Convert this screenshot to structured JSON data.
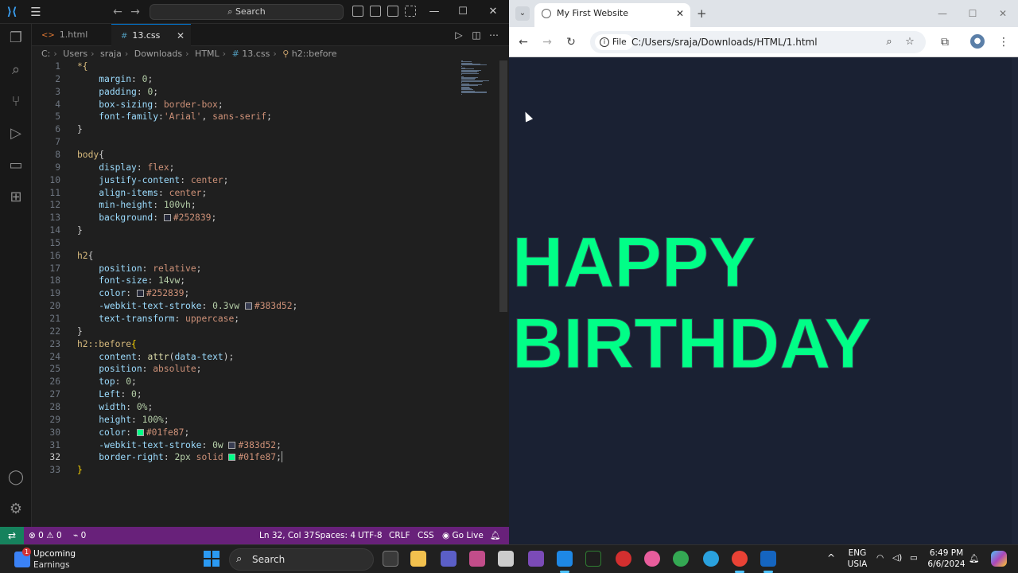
{
  "vscode": {
    "search_label": "Search",
    "tabs": [
      {
        "label": "1.html",
        "icon": "html-file-icon",
        "active": false
      },
      {
        "label": "13.css",
        "icon": "css-file-icon",
        "active": true
      }
    ],
    "breadcrumb": [
      "C:",
      "Users",
      "sraja",
      "Downloads",
      "HTML",
      "13.css",
      "h2::before"
    ],
    "code_lines": [
      [
        [
          "*{",
          "sel"
        ]
      ],
      [
        [
          "    ",
          ""
        ],
        [
          "margin",
          "prop"
        ],
        [
          ": ",
          "punc"
        ],
        [
          "0",
          "num"
        ],
        [
          ";",
          "punc"
        ]
      ],
      [
        [
          "    ",
          ""
        ],
        [
          "padding",
          "prop"
        ],
        [
          ": ",
          "punc"
        ],
        [
          "0",
          "num"
        ],
        [
          ";",
          "punc"
        ]
      ],
      [
        [
          "    ",
          ""
        ],
        [
          "box-sizing",
          "prop"
        ],
        [
          ": ",
          "punc"
        ],
        [
          "border-box",
          "val"
        ],
        [
          ";",
          "punc"
        ]
      ],
      [
        [
          "    ",
          ""
        ],
        [
          "font-family",
          "prop"
        ],
        [
          ":",
          "punc"
        ],
        [
          "'Arial'",
          "val"
        ],
        [
          ", ",
          "punc"
        ],
        [
          "sans-serif",
          "val"
        ],
        [
          ";",
          "punc"
        ]
      ],
      [
        [
          "}",
          "punc"
        ]
      ],
      [],
      [
        [
          "body",
          "sel"
        ],
        [
          "{",
          "punc"
        ]
      ],
      [
        [
          "    ",
          ""
        ],
        [
          "display",
          "prop"
        ],
        [
          ": ",
          "punc"
        ],
        [
          "flex",
          "val"
        ],
        [
          ";",
          "punc"
        ]
      ],
      [
        [
          "    ",
          ""
        ],
        [
          "justify-content",
          "prop"
        ],
        [
          ": ",
          "punc"
        ],
        [
          "center",
          "val"
        ],
        [
          ";",
          "punc"
        ]
      ],
      [
        [
          "    ",
          ""
        ],
        [
          "align-items",
          "prop"
        ],
        [
          ": ",
          "punc"
        ],
        [
          "center",
          "val"
        ],
        [
          ";",
          "punc"
        ]
      ],
      [
        [
          "    ",
          ""
        ],
        [
          "min-height",
          "prop"
        ],
        [
          ": ",
          "punc"
        ],
        [
          "100vh",
          "num"
        ],
        [
          ";",
          "punc"
        ]
      ],
      [
        [
          "    ",
          ""
        ],
        [
          "background",
          "prop"
        ],
        [
          ": ",
          "punc"
        ],
        [
          "#252839",
          "swatch:#252839"
        ],
        [
          "#252839",
          "val"
        ],
        [
          ";",
          "punc"
        ]
      ],
      [
        [
          "}",
          "punc"
        ]
      ],
      [],
      [
        [
          "h2",
          "sel"
        ],
        [
          "{",
          "punc"
        ]
      ],
      [
        [
          "    ",
          ""
        ],
        [
          "position",
          "prop"
        ],
        [
          ": ",
          "punc"
        ],
        [
          "relative",
          "val"
        ],
        [
          ";",
          "punc"
        ]
      ],
      [
        [
          "    ",
          ""
        ],
        [
          "font-size",
          "prop"
        ],
        [
          ": ",
          "punc"
        ],
        [
          "14vw",
          "num"
        ],
        [
          ";",
          "punc"
        ]
      ],
      [
        [
          "    ",
          ""
        ],
        [
          "color",
          "prop"
        ],
        [
          ": ",
          "punc"
        ],
        [
          "#252839",
          "swatch:#252839"
        ],
        [
          "#252839",
          "val"
        ],
        [
          ";",
          "punc"
        ]
      ],
      [
        [
          "    ",
          ""
        ],
        [
          "-webkit-text-stroke",
          "prop"
        ],
        [
          ": ",
          "punc"
        ],
        [
          "0.3vw",
          "num"
        ],
        [
          " ",
          "punc"
        ],
        [
          "#383d52",
          "swatch:#383d52"
        ],
        [
          "#383d52",
          "val"
        ],
        [
          ";",
          "punc"
        ]
      ],
      [
        [
          "    ",
          ""
        ],
        [
          "text-transform",
          "prop"
        ],
        [
          ": ",
          "punc"
        ],
        [
          "uppercase",
          "val"
        ],
        [
          ";",
          "punc"
        ]
      ],
      [
        [
          "}",
          "punc"
        ]
      ],
      [
        [
          "h2::before",
          "sel"
        ],
        [
          "{",
          "brace"
        ]
      ],
      [
        [
          "    ",
          ""
        ],
        [
          "content",
          "prop"
        ],
        [
          ": ",
          "punc"
        ],
        [
          "attr",
          "fn"
        ],
        [
          "(",
          "punc"
        ],
        [
          "data-text",
          "prop"
        ],
        [
          ");",
          "punc"
        ]
      ],
      [
        [
          "    ",
          ""
        ],
        [
          "position",
          "prop"
        ],
        [
          ": ",
          "punc"
        ],
        [
          "absolute",
          "val"
        ],
        [
          ";",
          "punc"
        ]
      ],
      [
        [
          "    ",
          ""
        ],
        [
          "top",
          "prop"
        ],
        [
          ": ",
          "punc"
        ],
        [
          "0",
          "num"
        ],
        [
          ";",
          "punc"
        ]
      ],
      [
        [
          "    ",
          ""
        ],
        [
          "Left",
          "prop"
        ],
        [
          ": ",
          "punc"
        ],
        [
          "0",
          "num"
        ],
        [
          ";",
          "punc"
        ]
      ],
      [
        [
          "    ",
          ""
        ],
        [
          "width",
          "prop"
        ],
        [
          ": ",
          "punc"
        ],
        [
          "0%",
          "num"
        ],
        [
          ";",
          "punc"
        ]
      ],
      [
        [
          "    ",
          ""
        ],
        [
          "height",
          "prop"
        ],
        [
          ": ",
          "punc"
        ],
        [
          "100%",
          "num"
        ],
        [
          ";",
          "punc"
        ]
      ],
      [
        [
          "    ",
          ""
        ],
        [
          "color",
          "prop"
        ],
        [
          ": ",
          "punc"
        ],
        [
          "#01fe87",
          "swatch:#01fe87"
        ],
        [
          "#01fe87",
          "val"
        ],
        [
          ";",
          "punc"
        ]
      ],
      [
        [
          "    ",
          ""
        ],
        [
          "-webkit-text-stroke",
          "prop"
        ],
        [
          ": ",
          "punc"
        ],
        [
          "0w",
          "num"
        ],
        [
          " ",
          "punc"
        ],
        [
          "#383d52",
          "swatch:#383d52"
        ],
        [
          "#383d52",
          "val"
        ],
        [
          ";",
          "punc"
        ]
      ],
      [
        [
          "    ",
          ""
        ],
        [
          "border-right",
          "prop"
        ],
        [
          ": ",
          "punc"
        ],
        [
          "2px",
          "num"
        ],
        [
          " solid ",
          "val"
        ],
        [
          "#01fe87",
          "swatch:#01fe87"
        ],
        [
          "#01fe87",
          "val"
        ],
        [
          ";",
          "punc"
        ],
        [
          "",
          "cursor"
        ]
      ],
      [
        [
          "}",
          "brace"
        ]
      ]
    ],
    "current_line": 32,
    "status": {
      "errors": "0",
      "warnings": "0",
      "ports": "0",
      "position": "Ln 32, Col 37",
      "spaces": "Spaces: 4",
      "encoding": "UTF-8",
      "eol": "CRLF",
      "language": "CSS",
      "golive": "Go Live"
    }
  },
  "browser": {
    "tab_title": "My First Website",
    "chip": "File",
    "url": "C:/Users/sraja/Downloads/HTML/1.html",
    "heading_line1": "Happy",
    "heading_line2": "Birthday"
  },
  "taskbar": {
    "weather_title": "Upcoming",
    "weather_sub": "Earnings",
    "weather_badge": "1",
    "search": "Search",
    "lang1": "ENG",
    "lang2": "USIA",
    "time": "6:49 PM",
    "date": "6/6/2024"
  },
  "colors": {
    "accent_green": "#01fe87",
    "page_bg": "#252839",
    "stroke": "#383d52",
    "statusbar": "#68217a"
  }
}
